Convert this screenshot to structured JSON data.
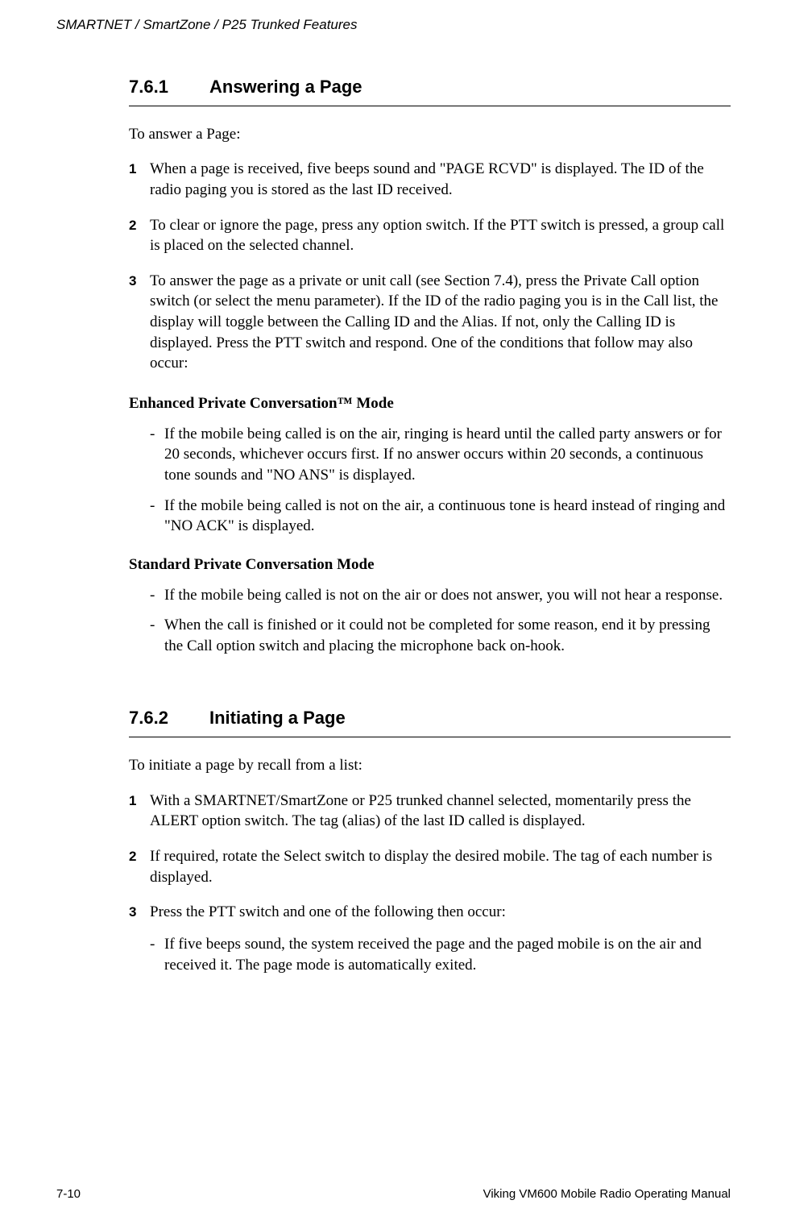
{
  "header": {
    "breadcrumb": "SMARTNET / SmartZone / P25 Trunked Features"
  },
  "section1": {
    "number": "7.6.1",
    "title": "Answering a Page",
    "intro": "To answer a Page:",
    "steps": [
      "When a page is received, five beeps sound and \"PAGE RCVD\" is displayed. The ID of the radio paging you is stored as the last ID received.",
      "To clear or ignore the page, press any option switch. If the PTT switch is pressed, a group call is placed on the selected channel.",
      "To answer the page as a private or unit call (see Section 7.4), press the Private Call option switch (or select the menu parameter). If the ID of the radio paging you is in the Call list, the display will toggle between the Calling ID and the Alias. If not, only the Calling ID is displayed. Press the PTT switch and respond. One of the conditions that follow may also occur:"
    ],
    "sub1_title": "Enhanced Private Conversation™ Mode",
    "sub1_items": [
      "If the mobile being called is on the air, ringing is heard until the called party answers or for 20 seconds, whichever occurs first. If no answer occurs within 20 seconds, a continuous tone sounds and \"NO ANS\" is displayed.",
      "If the mobile being called is not on the air, a continuous tone is heard instead of ringing and \"NO ACK\" is displayed."
    ],
    "sub2_title": "Standard Private Conversation Mode",
    "sub2_items": [
      "If the mobile being called is not on the air or does not answer, you will not hear a response.",
      "When the call is finished or it could not be completed for some reason, end it by pressing the Call option switch and placing the microphone back on-hook."
    ]
  },
  "section2": {
    "number": "7.6.2",
    "title": "Initiating a Page",
    "intro": "To initiate a page by recall from a list:",
    "steps": [
      "With a SMARTNET/SmartZone or P25 trunked channel selected, momentarily press the ALERT option switch. The tag (alias) of the last ID called is displayed.",
      "If required, rotate the Select switch to display the desired mobile. The tag of each number is displayed.",
      "Press the PTT switch and one of the following then occur:"
    ],
    "sub_items": [
      "If five beeps sound, the system received the page and the paged mobile is on the air and received it. The page mode is automatically exited."
    ]
  },
  "footer": {
    "page": "7-10",
    "doc": "Viking VM600 Mobile Radio Operating Manual"
  },
  "markers": {
    "n1": "1",
    "n2": "2",
    "n3": "3",
    "dash": "-"
  }
}
